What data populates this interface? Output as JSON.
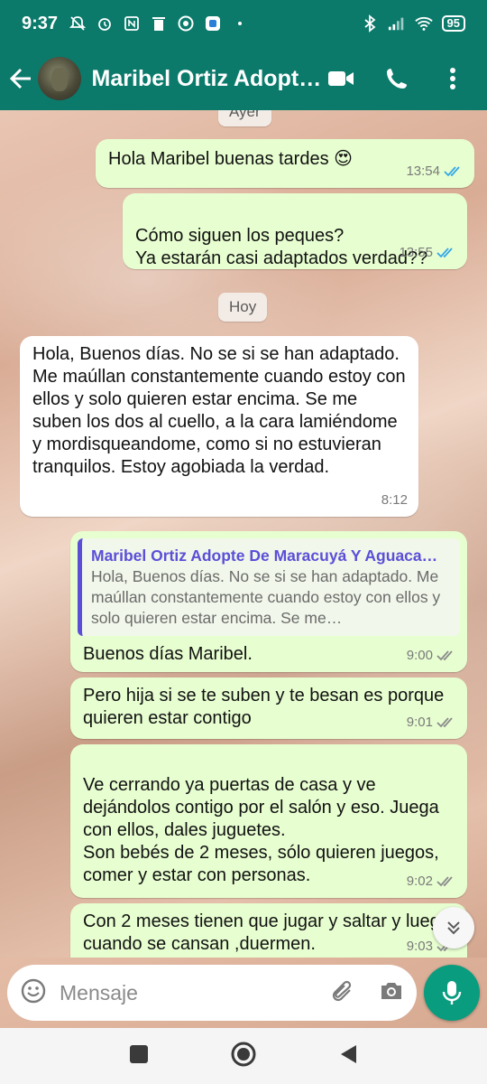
{
  "status_bar": {
    "time": "9:37",
    "battery": "95"
  },
  "header": {
    "title": "Maribel Ortiz Adopte De Maracuyá Y Aguaca…"
  },
  "chat": {
    "date_chips": [
      {
        "label": "Ayer"
      },
      {
        "label": "Hoy"
      }
    ],
    "messages": [
      {
        "text": "Hola Maribel buenas tardes 😍",
        "time": "13:54"
      },
      {
        "text": "Cómo siguen los peques?\nYa estarán casi adaptados verdad??",
        "time": "13:55"
      },
      {
        "text": "Hola, Buenos días.  No se si se han adaptado. Me maúllan constantemente cuando estoy con ellos y solo quieren estar encima. Se me suben los dos al cuello, a la cara lamiéndome y mordisqueandome, como si no estuvieran tranquilos. Estoy agobiada la verdad.",
        "time": "8:12"
      },
      {
        "quote_name": "Maribel Ortiz Adopte De Maracuyá Y Aguaca…",
        "quote_text": "Hola, Buenos días.  No se si se han adaptado. Me maúllan constantemente cuando estoy con ellos y solo quieren estar encima. Se me…",
        "text": "Buenos días Maribel.",
        "time": "9:00"
      },
      {
        "text": "Pero hija si se te suben y te besan es porque quieren estar contigo",
        "time": "9:01"
      },
      {
        "text": "Ve cerrando ya puertas de casa y ve dejándolos contigo por el salón y eso. Juega con ellos, dales juguetes.\nSon bebés de 2 meses, sólo quieren juegos, comer y estar con personas.",
        "time": "9:02"
      },
      {
        "text": "Con 2 meses tienen que jugar y saltar y luego cuando se cansan ,duermen.",
        "time": "9:03"
      }
    ]
  },
  "input": {
    "placeholder": "Mensaje"
  },
  "colors": {
    "header": "#0b7a6b",
    "outgoing_bubble": "#e7fed0",
    "incoming_bubble": "#ffffff",
    "read_ticks": "#34a7e8",
    "mic_button": "#0a9c7f"
  }
}
